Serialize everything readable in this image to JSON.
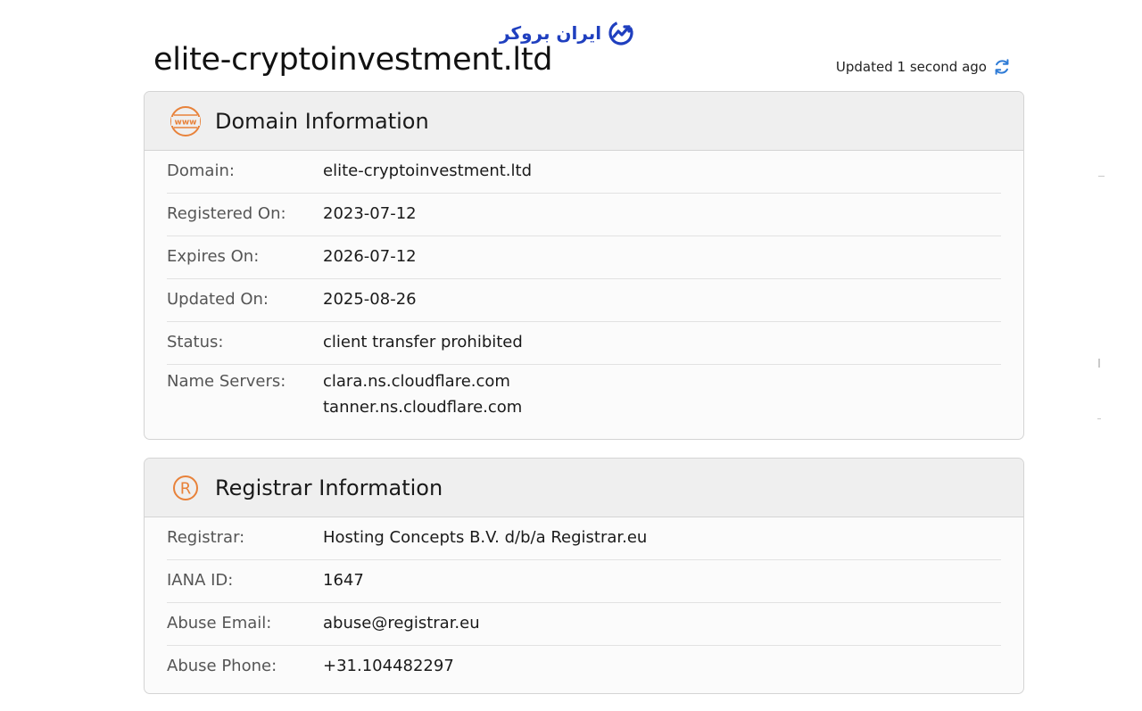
{
  "brand": {
    "name": "ایران بروکر",
    "color": "#1f3fbf",
    "icon": "chart-up-icon"
  },
  "header": {
    "title": "elite-cryptoinvestment.ltd",
    "updated_text": "Updated 1 second ago",
    "refresh_icon": "refresh-icon"
  },
  "domain_info": {
    "title": "Domain Information",
    "icon": "www-icon",
    "rows": [
      {
        "label": "Domain:",
        "value": "elite-cryptoinvestment.ltd"
      },
      {
        "label": "Registered On:",
        "value": "2023-07-12"
      },
      {
        "label": "Expires On:",
        "value": "2026-07-12"
      },
      {
        "label": "Updated On:",
        "value": "2025-08-26"
      },
      {
        "label": "Status:",
        "value": "client transfer prohibited"
      }
    ],
    "name_servers": {
      "label": "Name Servers:",
      "values": [
        "clara.ns.cloudflare.com",
        "tanner.ns.cloudflare.com"
      ]
    }
  },
  "registrar_info": {
    "title": "Registrar Information",
    "icon": "registered-icon",
    "rows": [
      {
        "label": "Registrar:",
        "value": "Hosting Concepts B.V. d/b/a Registrar.eu"
      },
      {
        "label": "IANA ID:",
        "value": "1647"
      },
      {
        "label": "Abuse Email:",
        "value": "abuse@registrar.eu"
      },
      {
        "label": "Abuse Phone:",
        "value": "+31.104482297"
      }
    ]
  },
  "colors": {
    "accent": "#e8823a",
    "refresh": "#2e7bd6",
    "brand": "#1f3fbf"
  }
}
